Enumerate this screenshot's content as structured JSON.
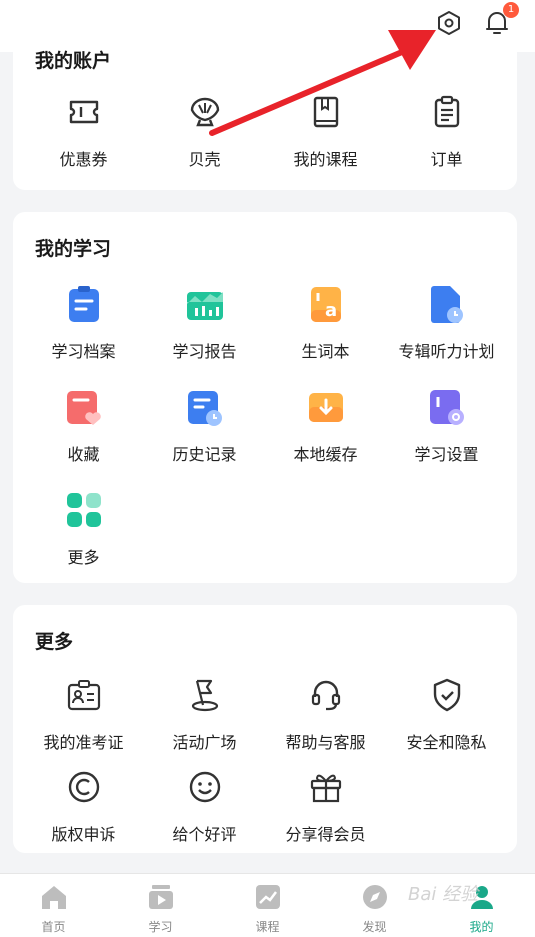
{
  "topbar": {
    "notification_count": "1"
  },
  "account": {
    "title": "我的账户",
    "items": [
      {
        "label": "优惠券",
        "icon": "coupon-icon"
      },
      {
        "label": "贝壳",
        "icon": "shell-icon"
      },
      {
        "label": "我的课程",
        "icon": "book-icon"
      },
      {
        "label": "订单",
        "icon": "order-icon"
      }
    ]
  },
  "study": {
    "title": "我的学习",
    "items": [
      {
        "label": "学习档案",
        "icon": "study-archive-icon"
      },
      {
        "label": "学习报告",
        "icon": "study-report-icon"
      },
      {
        "label": "生词本",
        "icon": "vocabulary-icon"
      },
      {
        "label": "专辑听力计划",
        "icon": "listening-plan-icon"
      },
      {
        "label": "收藏",
        "icon": "favorites-icon"
      },
      {
        "label": "历史记录",
        "icon": "history-icon"
      },
      {
        "label": "本地缓存",
        "icon": "local-cache-icon"
      },
      {
        "label": "学习设置",
        "icon": "study-settings-icon"
      },
      {
        "label": "更多",
        "icon": "more-apps-icon"
      }
    ]
  },
  "more": {
    "title": "更多",
    "items": [
      {
        "label": "我的准考证",
        "icon": "admission-ticket-icon"
      },
      {
        "label": "活动广场",
        "icon": "activity-flag-icon"
      },
      {
        "label": "帮助与客服",
        "icon": "headset-icon"
      },
      {
        "label": "安全和隐私",
        "icon": "shield-icon"
      },
      {
        "label": "版权申诉",
        "icon": "copyright-icon"
      },
      {
        "label": "给个好评",
        "icon": "smiley-icon"
      },
      {
        "label": "分享得会员",
        "icon": "gift-icon"
      }
    ]
  },
  "nav": [
    {
      "label": "首页",
      "icon": "home-icon"
    },
    {
      "label": "学习",
      "icon": "play-book-icon"
    },
    {
      "label": "课程",
      "icon": "chart-icon"
    },
    {
      "label": "发现",
      "icon": "compass-icon"
    },
    {
      "label": "我的",
      "icon": "profile-icon"
    }
  ],
  "watermark": "Bai 经验",
  "colors": {
    "accent": "#1aa889",
    "badge": "#ff5a3c",
    "arrow": "#e8232a"
  }
}
